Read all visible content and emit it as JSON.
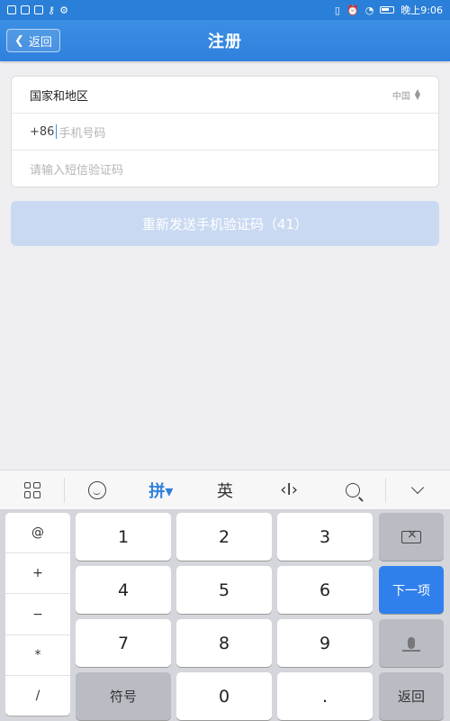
{
  "status_bar": {
    "time": "晚上9:06"
  },
  "header": {
    "back_label": "返回",
    "title": "注册"
  },
  "form": {
    "region_label": "国家和地区",
    "region_value": "中国",
    "phone_prefix": "+86",
    "phone_placeholder": "手机号码",
    "sms_placeholder": "请输入短信验证码"
  },
  "resend_button": "重新发送手机验证码（41）",
  "keyboard": {
    "toolbar": {
      "pinyin": "拼▾",
      "english": "英",
      "cursor": "‹I›"
    },
    "symbols": [
      "@",
      "+",
      "−",
      "*",
      "/"
    ],
    "keys": {
      "k1": "1",
      "k2": "2",
      "k3": "3",
      "k4": "4",
      "k5": "5",
      "k6": "6",
      "k7": "7",
      "k8": "8",
      "k9": "9",
      "k0": "0",
      "dot": ".",
      "symbol": "符号",
      "next": "下一项",
      "back": "返回"
    }
  }
}
